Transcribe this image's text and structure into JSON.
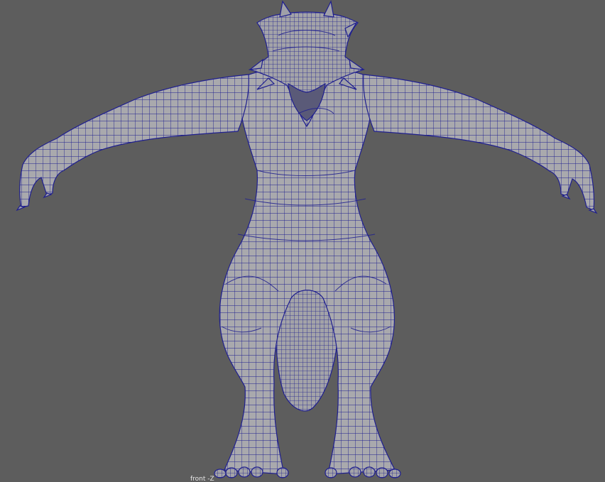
{
  "viewport": {
    "camera_name": "front -Z",
    "background_color": "#5d5d5d",
    "mesh_fill_color": "#a9a9ad",
    "wireframe_color": "#1f1f8f"
  },
  "model": {
    "icon": "creature-mesh-icon"
  }
}
